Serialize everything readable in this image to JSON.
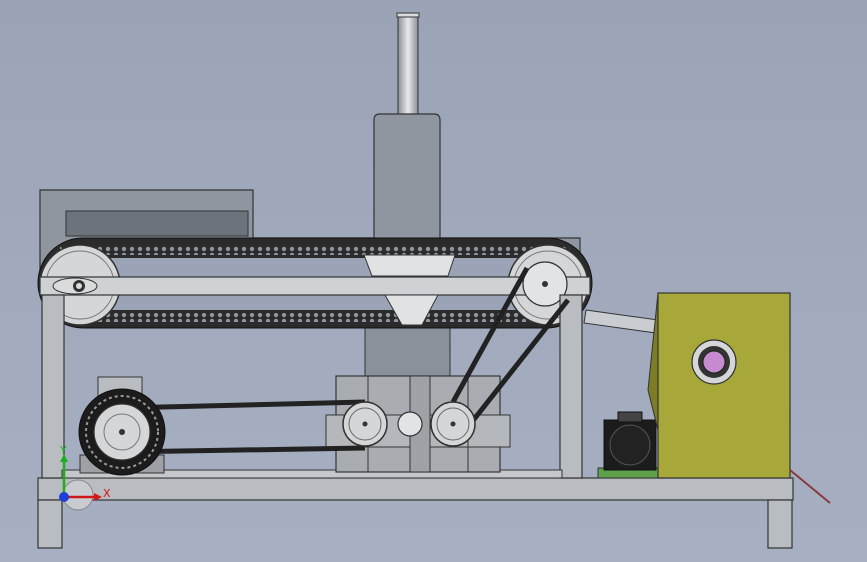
{
  "viewport": {
    "background_top": "#9aa4b6",
    "background_bottom": "#a6b0c2"
  },
  "colors": {
    "frame": "#b9bcc0",
    "frame_edge": "#3a3a3a",
    "housing": "#8f96a0",
    "belt": "#2b2b2b",
    "pulley": "#d4d6d8",
    "motor_dark": "#1c1c1c",
    "gearbox": "#a9adb1",
    "olive_box": "#a8a83a",
    "olive_side": "#7d7d28",
    "bearing": "#c58ad0",
    "axis_x": "#d01818",
    "axis_y": "#1ab01a",
    "axis_z": "#1f3fd6"
  },
  "triad": {
    "x_label": "X",
    "y_label": "Y"
  },
  "parts": [
    "top-cylinder",
    "upper-housing",
    "conveyor-belt",
    "hopper",
    "drive-motor",
    "gearbox",
    "servo-motor",
    "olive-module",
    "base-frame"
  ]
}
